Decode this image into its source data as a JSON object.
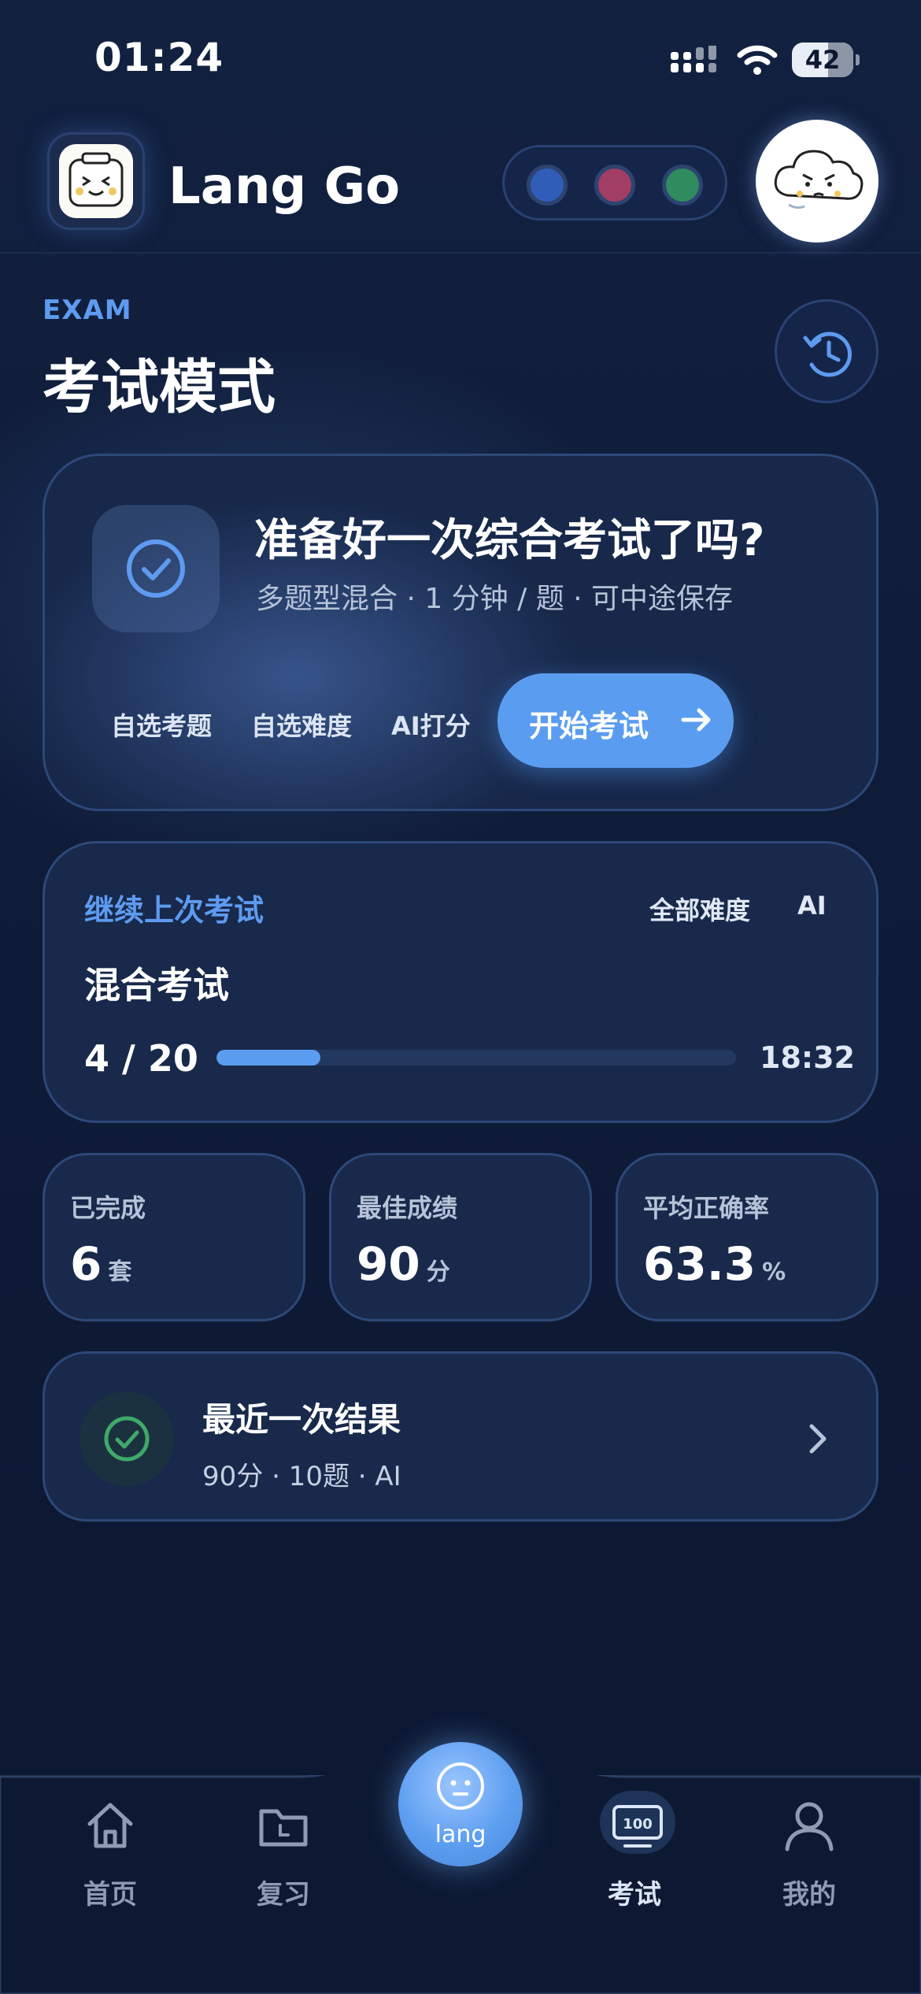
{
  "status_bar": {
    "time": "01:24",
    "battery": "42",
    "battery_level": 0.42
  },
  "header": {
    "app_name": "Lang Go",
    "color_dots": [
      "#2f5db8",
      "#a23d63",
      "#2f8c5e"
    ]
  },
  "page": {
    "eyebrow": "EXAM",
    "title": "考试模式"
  },
  "hero": {
    "title": "准备好一次综合考试了吗?",
    "subtitle": "多题型混合 · 1 分钟 / 题 · 可中途保存",
    "chips": [
      "自选考题",
      "自选难度",
      "AI打分"
    ],
    "start_label": "开始考试"
  },
  "continue_card": {
    "label": "继续上次考试",
    "tags": [
      "全部难度",
      "AI"
    ],
    "title": "混合考试",
    "progress_text": "4 / 20",
    "progress": 0.2,
    "time": "18:32"
  },
  "stats": [
    {
      "label": "已完成",
      "value": "6",
      "unit": "套"
    },
    {
      "label": "最佳成绩",
      "value": "90",
      "unit": "分"
    },
    {
      "label": "平均正确率",
      "value": "63.3",
      "unit": "%"
    }
  ],
  "recent": {
    "title": "最近一次结果",
    "subtitle": "90分 · 10题 · AI"
  },
  "nav": {
    "items": [
      {
        "label": "首页",
        "icon": "home-icon"
      },
      {
        "label": "复习",
        "icon": "folder-icon"
      },
      {
        "label": "考试",
        "icon": "exam-100-icon"
      },
      {
        "label": "我的",
        "icon": "profile-icon"
      }
    ],
    "center_label": "lang",
    "active": "考试"
  },
  "colors": {
    "accent": "#5a9df0",
    "background": "#0c1730",
    "card": "#18294b"
  }
}
